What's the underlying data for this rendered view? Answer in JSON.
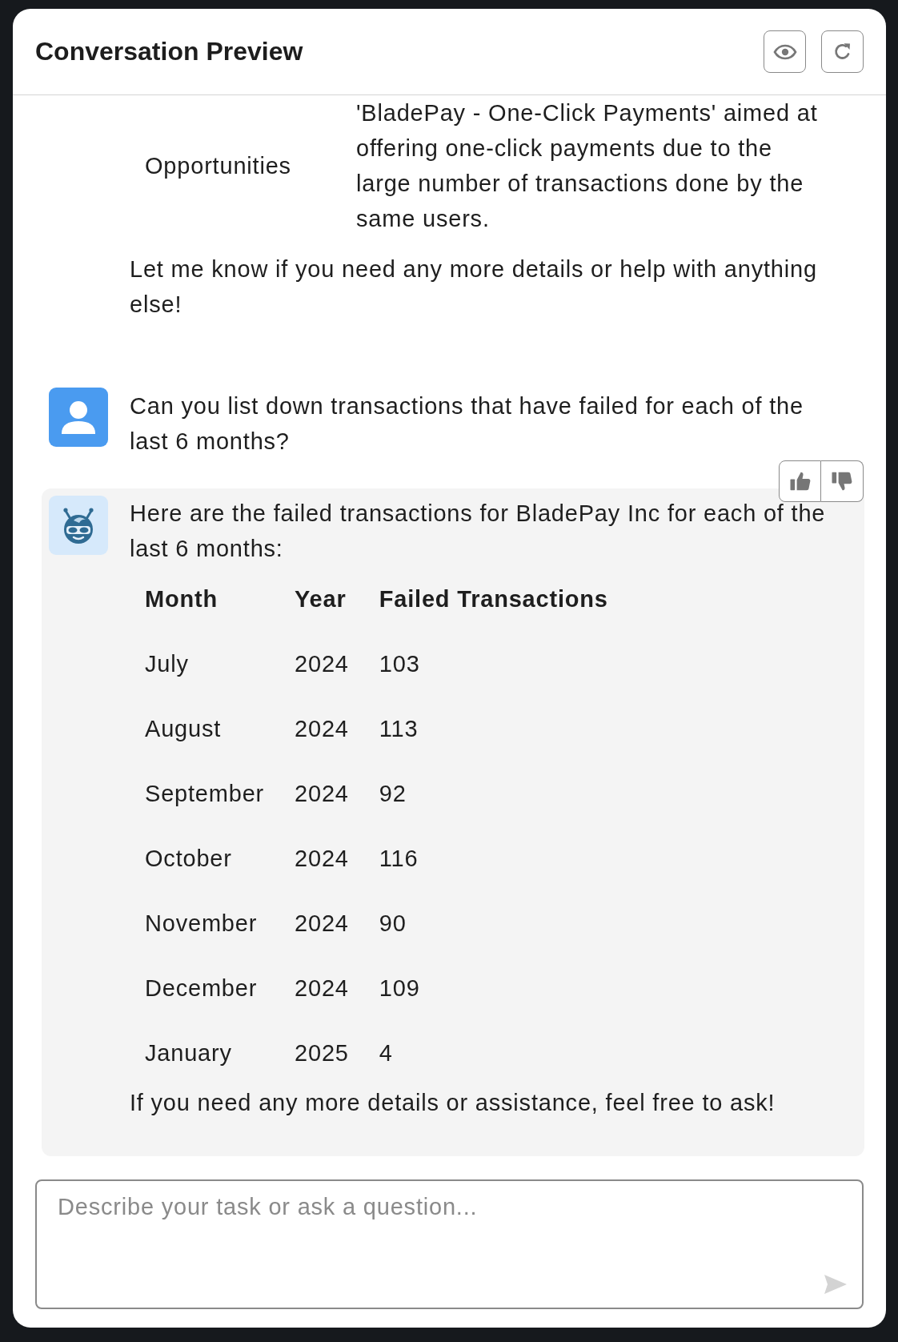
{
  "header": {
    "title": "Conversation Preview"
  },
  "messages": [
    {
      "kind": "assistant-tail",
      "hovered": false,
      "blocks": [
        {
          "kind": "table",
          "rows": [
            [
              "Opportunities",
              "'BladePay - One-Click Payments' aimed at offering one-click payments due to the large number of transactions done by the same users."
            ]
          ]
        },
        {
          "kind": "text",
          "text": "Let me know if you need any more details or help with anything else!"
        }
      ]
    },
    {
      "kind": "user",
      "hovered": false,
      "blocks": [
        {
          "kind": "text",
          "text": "Can you list down transactions that have failed for each of the last 6 months?"
        }
      ]
    },
    {
      "kind": "assistant",
      "hovered": true,
      "blocks": [
        {
          "kind": "text",
          "text": "Here are the failed transactions for BladePay Inc for each of the last 6 months:"
        },
        {
          "kind": "table",
          "columns": [
            "Month",
            "Year",
            "Failed Transactions"
          ],
          "rows": [
            [
              "July",
              "2024",
              "103"
            ],
            [
              "August",
              "2024",
              "113"
            ],
            [
              "September",
              "2024",
              "92"
            ],
            [
              "October",
              "2024",
              "116"
            ],
            [
              "November",
              "2024",
              "90"
            ],
            [
              "December",
              "2024",
              "109"
            ],
            [
              "January",
              "2025",
              "4"
            ]
          ]
        },
        {
          "kind": "text",
          "text": "If you need any more details or assistance, feel free to ask!"
        }
      ]
    }
  ],
  "composer": {
    "placeholder": "Describe your task or ask a question...",
    "send_disabled": true
  }
}
